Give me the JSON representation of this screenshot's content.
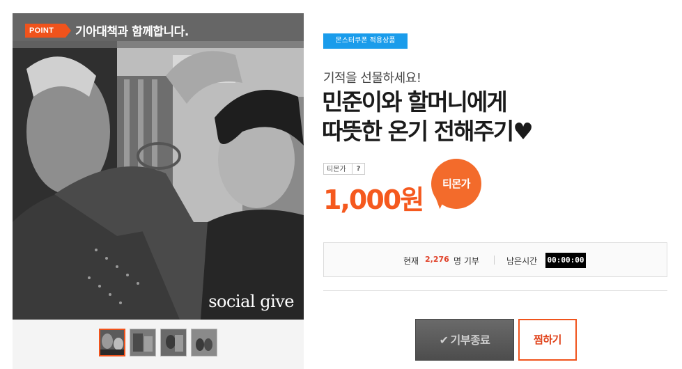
{
  "image": {
    "point_tag": "POINT",
    "point_text": "기아대책과 함께합니다.",
    "watermark": "social give",
    "thumbnails": [
      {
        "name": "thumb-1",
        "active": true
      },
      {
        "name": "thumb-2",
        "active": false
      },
      {
        "name": "thumb-3",
        "active": false
      },
      {
        "name": "thumb-4",
        "active": false
      }
    ]
  },
  "product": {
    "coupon_badge": "몬스터쿠폰 적용상품",
    "subtitle": "기적을 선물하세요!",
    "title_line1": "민준이와 할머니에게",
    "title_line2": "따뜻한 온기 전해주기♥",
    "price_label": "티몬가",
    "help": "?",
    "price": "1,000원",
    "bubble": "티몬가"
  },
  "stats": {
    "now_label": "현재",
    "now_count": "2,276",
    "now_unit": "명 기부",
    "left_label": "남은시간",
    "timer": "00:00:00"
  },
  "actions": {
    "donate_label": "기부종료",
    "wish_label": "찜하기"
  },
  "colors": {
    "accent": "#f5591e",
    "coupon": "#1a9ceb",
    "count": "#e0422a"
  }
}
